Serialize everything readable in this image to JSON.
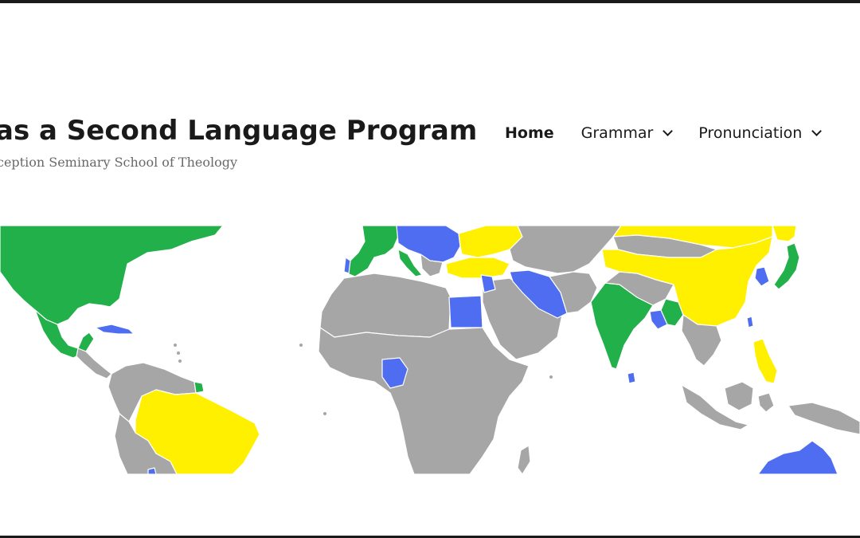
{
  "header": {
    "site_title": "as a Second Language Program",
    "site_tagline": "ception Seminary School of Theology"
  },
  "nav": {
    "items": [
      {
        "label": "Home",
        "active": true,
        "has_dropdown": false
      },
      {
        "label": "Grammar",
        "active": false,
        "has_dropdown": true
      },
      {
        "label": "Pronunciation",
        "active": false,
        "has_dropdown": true
      }
    ]
  },
  "hero_map": {
    "colors": {
      "green": "#22b04a",
      "blue": "#4f6df0",
      "yellow": "#fff000",
      "gray": "#a6a6a6",
      "border": "#ffffff"
    }
  }
}
